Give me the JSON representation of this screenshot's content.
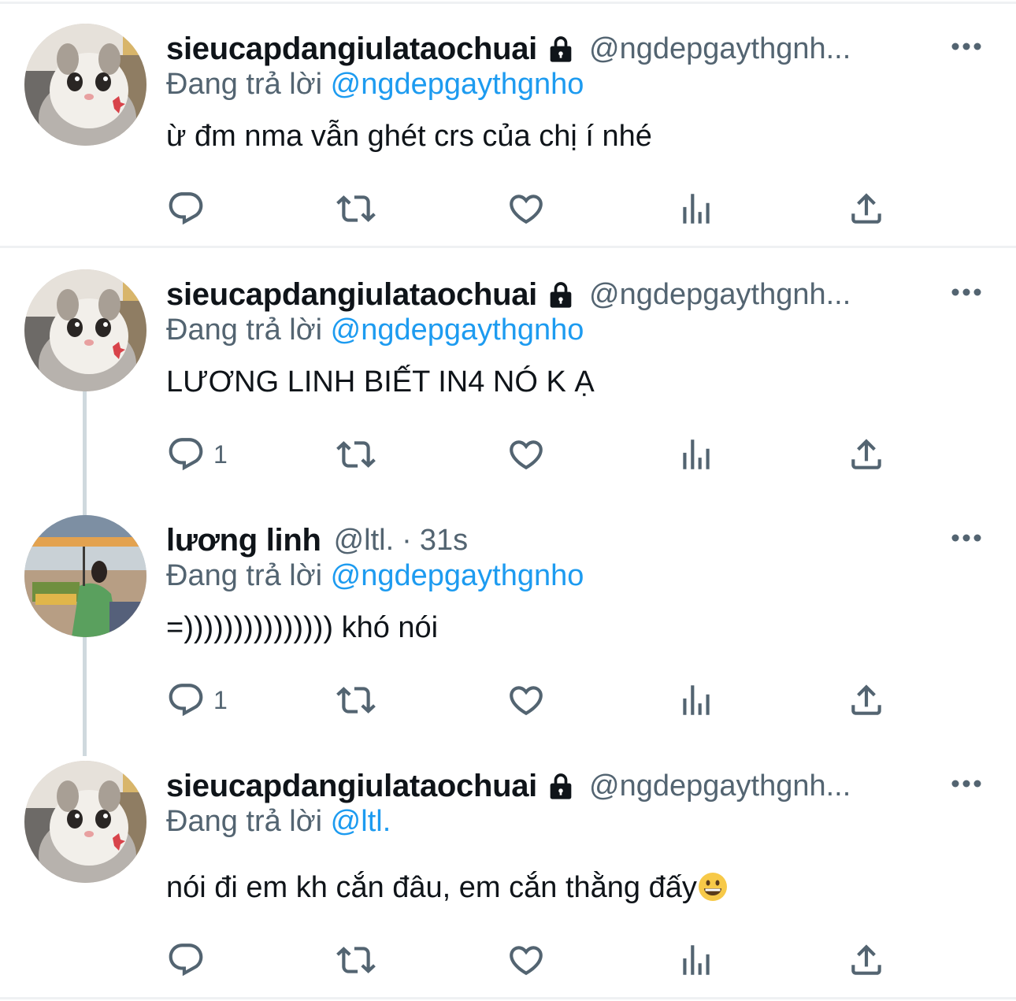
{
  "tweets": [
    {
      "name": "sieucapdangiulataochuai",
      "handle": "@ngdepgaythgnh...",
      "time": "",
      "reply_label": "Đang trả lời",
      "reply_to": "@ngdepgaythgnho",
      "text": "ừ đm nma vẫn ghét crs của chị í nhé",
      "reply_count": "",
      "locked": true
    },
    {
      "name": "sieucapdangiulataochuai",
      "handle": "@ngdepgaythgnh...",
      "time": "",
      "reply_label": "Đang trả lời",
      "reply_to": "@ngdepgaythgnho",
      "text": "LƯƠNG LINH BIẾT IN4 NÓ K Ạ",
      "reply_count": "1",
      "locked": true
    },
    {
      "name": "lương linh",
      "handle": "@ltl.",
      "separator": "·",
      "time": "31s",
      "reply_label": "Đang trả lời",
      "reply_to": "@ngdepgaythgnho",
      "text": "=))))))))))))))) khó nói",
      "reply_count": "1",
      "locked": false
    },
    {
      "name": "sieucapdangiulataochuai",
      "handle": "@ngdepgaythgnh...",
      "time": "",
      "reply_label": "Đang trả lời",
      "reply_to": "@ltl.",
      "text": "nói đi em kh cắn đâu, em cắn thằng đấy",
      "reply_count": "",
      "locked": true,
      "emoji": "grinning-face"
    }
  ],
  "icons": {
    "reply": "reply-icon",
    "retweet": "retweet-icon",
    "like": "heart-icon",
    "views": "views-icon",
    "share": "share-icon",
    "more": "more-icon",
    "lock": "lock-icon"
  },
  "colors": {
    "name": "#0f1419",
    "secondary": "#536471",
    "mention": "#1d9bf0",
    "divider": "#eff1f3",
    "thread_line": "#cfd9de"
  }
}
